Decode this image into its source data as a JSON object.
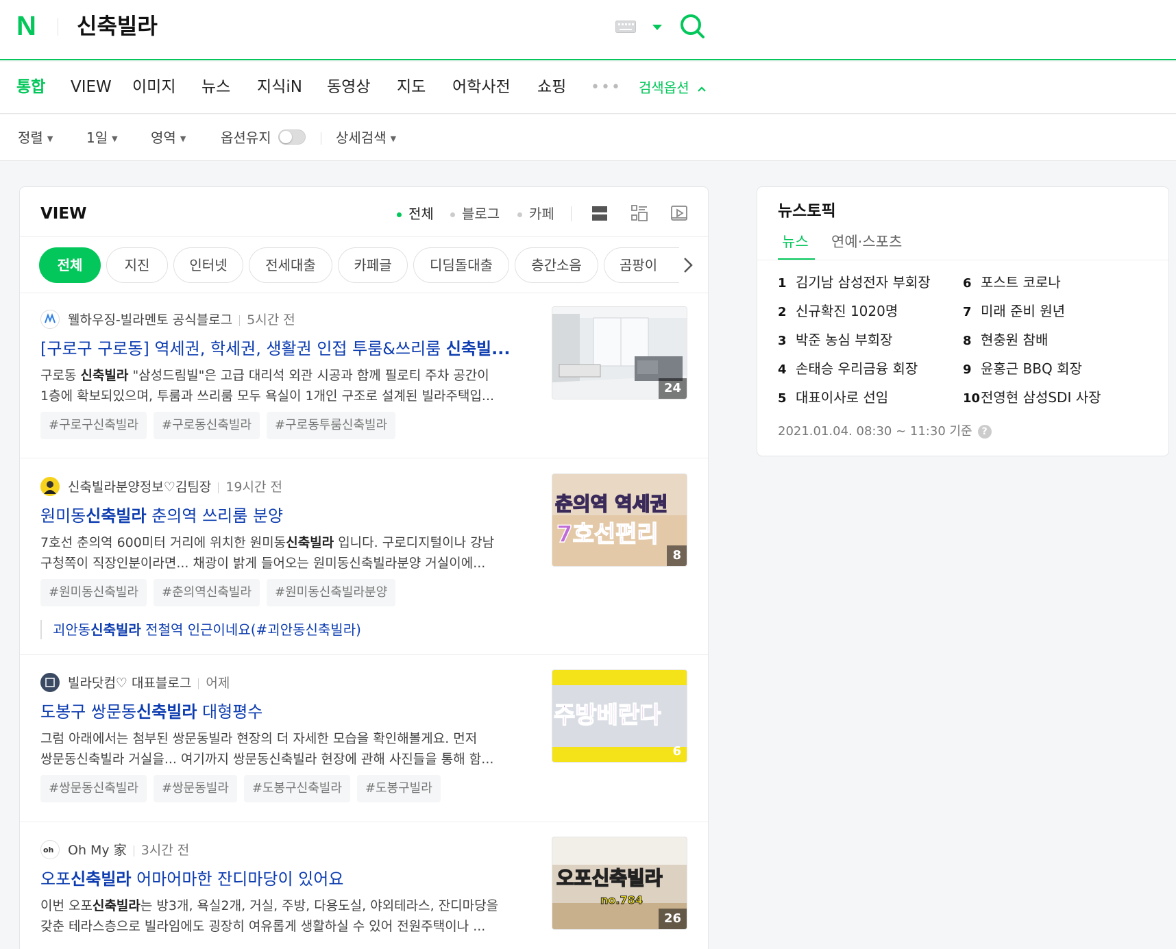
{
  "header": {
    "logo": "N",
    "query": "신축빌라"
  },
  "tabs": [
    {
      "label": "통합",
      "active": true
    },
    {
      "label": "VIEW"
    },
    {
      "label": "이미지"
    },
    {
      "label": "뉴스"
    },
    {
      "label": "지식iN"
    },
    {
      "label": "동영상"
    },
    {
      "label": "지도"
    },
    {
      "label": "어학사전"
    },
    {
      "label": "쇼핑"
    }
  ],
  "tabs_more": "•••",
  "search_options_label": "검색옵션",
  "options": {
    "sort": "정렬",
    "period": "1일",
    "area": "영역",
    "keep": "옵션유지",
    "detail": "상세검색"
  },
  "view": {
    "title": "VIEW",
    "filters": [
      "전체",
      "블로그",
      "카페"
    ],
    "chips": [
      "전체",
      "지진",
      "인터넷",
      "전세대출",
      "카페글",
      "디딤돌대출",
      "층간소음",
      "곰팡이"
    ],
    "posts": [
      {
        "source": "웰하우징-빌라멘토 공식블로그",
        "time": "5시간 전",
        "title_pre": "[구로구 구로동] 역세권, 학세권, 생활권 인접 투룸&쓰리룸 ",
        "title_bold": "신축빌...",
        "title_post": "",
        "desc1_pre": "구로동 ",
        "desc1_bold": "신축빌라",
        "desc1_post": " \"삼성드림빌\"은 고급 대리석 외관 시공과 함께 필로티 주차 공간이",
        "desc2": "1층에 확보되있으며, 투룸과 쓰리룸 모두 욕실이 1개인 구조로 설계된 빌라주택입...",
        "tags": [
          "#구로구신축빌라",
          "#구로동신축빌라",
          "#구로동투룸신축빌라"
        ],
        "count": "24"
      },
      {
        "source": "신축빌라분양정보♡김팀장",
        "time": "19시간 전",
        "title_pre": "원미동",
        "title_bold": "신축빌라",
        "title_post": " 춘의역 쓰리룸 분양",
        "desc1_pre": "7호선 춘의역 600미터 거리에 위치한 원미동",
        "desc1_bold": "신축빌라",
        "desc1_post": " 입니다. 구로디지털이나 강남",
        "desc2": "구청쪽이 직장인분이라면... 채광이 밝게 들어오는 원미동신축빌라분양 거실이에...",
        "tags": [
          "#원미동신축빌라",
          "#춘의역신축빌라",
          "#원미동신축빌라분양"
        ],
        "count": "8",
        "thumb_text1": "춘의역 역세권",
        "thumb_text2": "7호선편리",
        "extra_pre": "괴안동",
        "extra_bold": "신축빌라",
        "extra_post": " 전철역 인근이네요(#괴안동신축빌라)"
      },
      {
        "source": "빌라닷컴♡ 대표블로그",
        "time": "어제",
        "title_pre": "도봉구 쌍문동",
        "title_bold": "신축빌라",
        "title_post": " 대형평수",
        "desc1_pre": "",
        "desc1_bold": "",
        "desc1_post": "그럼 아래에서는 첨부된 쌍문동빌라 현장의 더 자세한 모습을 확인해볼게요. 먼저",
        "desc2": "쌍문동신축빌라 거실을... 여기까지 쌍문동신축빌라 현장에 관해 사진들을 통해 함...",
        "tags": [
          "#쌍문동신축빌라",
          "#쌍문동빌라",
          "#도봉구신축빌라",
          "#도봉구빌라"
        ],
        "count": "6",
        "thumb_text1": "주방베란다"
      },
      {
        "source": "Oh My 家",
        "time": "3시간 전",
        "title_pre": "오포",
        "title_bold": "신축빌라",
        "title_post": " 어마어마한 잔디마당이 있어요",
        "desc1_pre": "이번 오포",
        "desc1_bold": "신축빌라",
        "desc1_post": "는 방3개, 욕실2개, 거실, 주방, 다용도실, 야외테라스, 잔디마당을",
        "desc2": "갖춘 테라스층으로 빌라임에도 굉장히 여유롭게 생활하실 수 있어 전원주택이나 ...",
        "count": "26",
        "thumb_text1": "오포신축빌라",
        "thumb_text2": "no.784"
      }
    ]
  },
  "news": {
    "title": "뉴스토픽",
    "tabs": [
      "뉴스",
      "연예·스포츠"
    ],
    "topics": [
      {
        "rank": "1",
        "text": "김기남 삼성전자 부회장"
      },
      {
        "rank": "2",
        "text": "신규확진 1020명"
      },
      {
        "rank": "3",
        "text": "박준 농심 부회장"
      },
      {
        "rank": "4",
        "text": "손태승 우리금융 회장"
      },
      {
        "rank": "5",
        "text": "대표이사로 선임"
      },
      {
        "rank": "6",
        "text": "포스트 코로나"
      },
      {
        "rank": "7",
        "text": "미래 준비 원년"
      },
      {
        "rank": "8",
        "text": "현충원 참배"
      },
      {
        "rank": "9",
        "text": "윤홍근 BBQ 회장"
      },
      {
        "rank": "10",
        "text": "전영현 삼성SDI 사장"
      }
    ],
    "time": "2021.01.04. 08:30 ~ 11:30 기준",
    "help": "?"
  },
  "colors": {
    "accent": "#03c75a",
    "link": "#0c3cb0"
  }
}
